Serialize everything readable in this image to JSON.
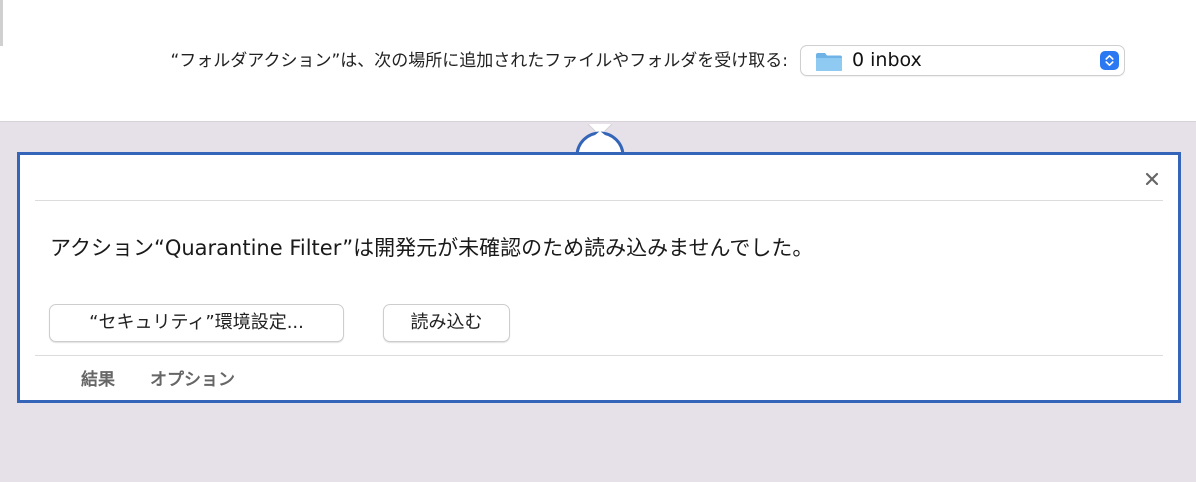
{
  "folder_action": {
    "receive_label": "“フォルダアクション”は、次の場所に追加されたファイルやフォルダを受け取る:",
    "folder_name": "0 inbox",
    "folder_icon": "folder-icon",
    "stepper_icon": "popup-stepper-icon"
  },
  "action_card": {
    "message": "アクション“Quarantine Filter”は開発元が未確認のため読み込みませんでした。",
    "security_button_label": "“セキュリティ”環境設定...",
    "load_button_label": "読み込む",
    "close_icon": "close-icon",
    "tabs": [
      {
        "label": "結果"
      },
      {
        "label": "オプション"
      }
    ]
  },
  "colors": {
    "card_border": "#3465b8",
    "pane_background": "#e6e1e8",
    "stepper_blue": "#2a78f2"
  }
}
